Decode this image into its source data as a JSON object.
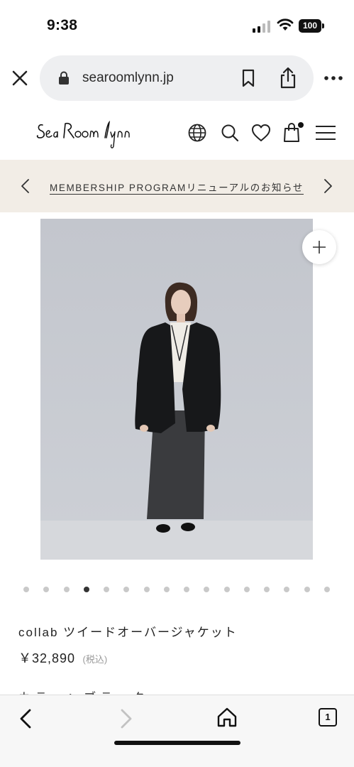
{
  "status_bar": {
    "time": "9:38",
    "battery": "100"
  },
  "browser": {
    "url": "searoomlynn.jp",
    "tab_count": "1"
  },
  "site": {
    "logo_text": "Sea Room lynn",
    "icons": [
      "globe-icon",
      "search-icon",
      "heart-icon",
      "bag-icon",
      "menu-icon"
    ]
  },
  "announcement": {
    "text": "MEMBERSHIP PROGRAMリニューアルのお知らせ"
  },
  "gallery": {
    "dot_count": 16,
    "active_index": 3
  },
  "product": {
    "name": "collab ツイードオーバージャケット",
    "price": "￥32,890",
    "tax_note": "(税込)",
    "partial_label": "カラー：ブラック"
  },
  "colors": {
    "announce_bg": "#f2ede6",
    "photo_bg": "#c9ccd2"
  }
}
